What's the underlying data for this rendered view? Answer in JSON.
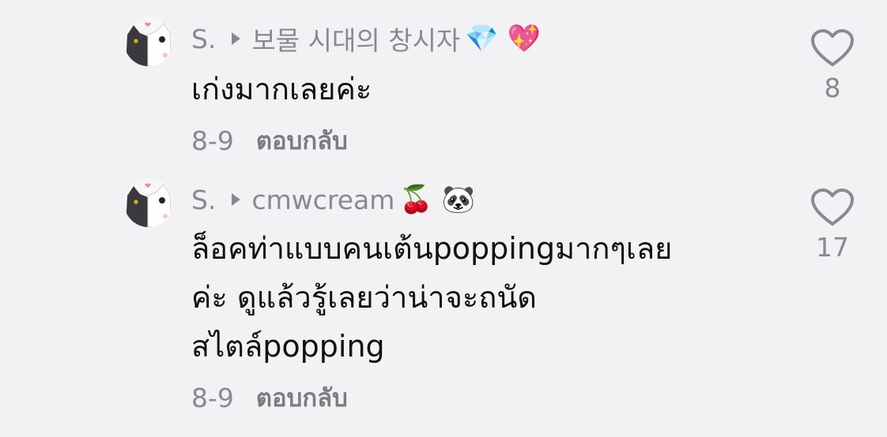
{
  "comments": [
    {
      "author": "S.",
      "reply_to": "보물 시대의 창시자",
      "reply_to_emoji": "💎 💖",
      "text_lines": [
        "เก่งมากเลยค่ะ"
      ],
      "date": "8-9",
      "reply_label": "ตอบกลับ",
      "likes": "8"
    },
    {
      "author": "S.",
      "reply_to": "cmwcream",
      "reply_to_emoji": "🍒 🐼",
      "text_lines": [
        "ล็อคท่าแบบคนเต้นpoppingมากๆเลย",
        "ค่ะ ดูแล้วรู้เลยว่าน่าจะถนัด",
        "สไตล์popping"
      ],
      "date": "8-9",
      "reply_label": "ตอบกลับ",
      "likes": "17"
    }
  ],
  "icons": {
    "avatar": "cat-avatar",
    "like": "heart-outline-icon",
    "reply_arrow": "caret-right-icon"
  },
  "colors": {
    "background": "#f2f2f4",
    "text": "#111111",
    "muted": "#8a8a8e"
  }
}
